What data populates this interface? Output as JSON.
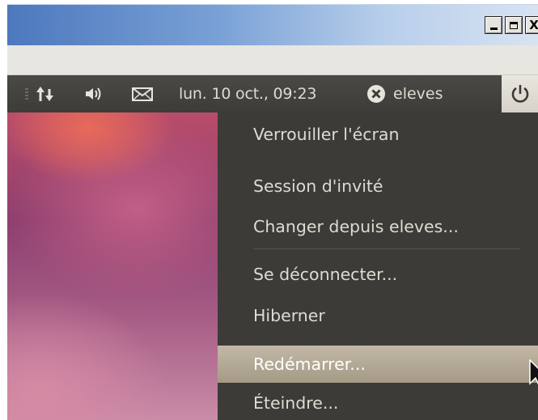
{
  "window": {
    "minimize_label": "_",
    "maximize_label": "□",
    "close_label": "X"
  },
  "panel": {
    "clock": "lun. 10 oct., 09:23",
    "user": "eleves",
    "icons": [
      "network-updown-icon",
      "volume-icon",
      "mail-envelope-icon",
      "user-status-icon",
      "power-icon"
    ]
  },
  "session_menu": {
    "items": [
      {
        "label": "Verrouiller l'écran"
      },
      {
        "label": "Session d'invité"
      },
      {
        "label": "Changer depuis eleves..."
      },
      {
        "label": "Se déconnecter..."
      },
      {
        "label": "Hiberner"
      },
      {
        "label": "Redémarrer..."
      },
      {
        "label": "Éteindre..."
      }
    ],
    "selected_index": 5
  },
  "colors": {
    "panel_bg": "#3c3b37",
    "panel_text": "#dfdbd2",
    "menu_highlight": "#b5aa97",
    "power_button_bg": "#e2dfd8"
  }
}
